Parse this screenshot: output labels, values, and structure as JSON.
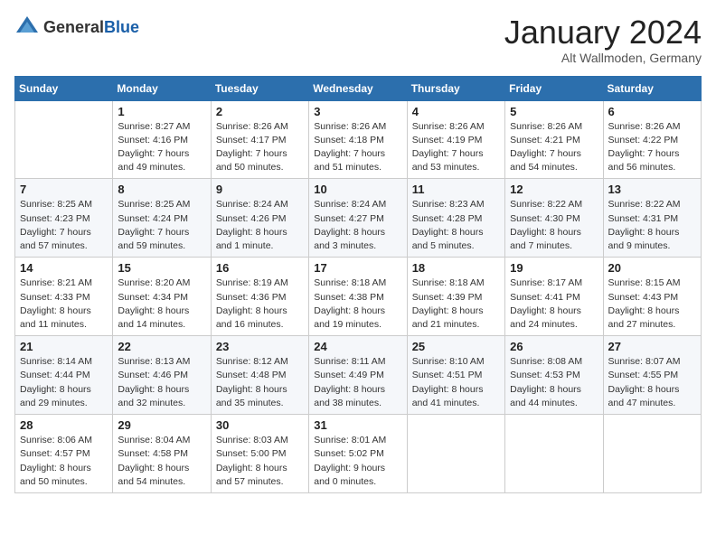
{
  "header": {
    "logo_general": "General",
    "logo_blue": "Blue",
    "month": "January 2024",
    "location": "Alt Wallmoden, Germany"
  },
  "calendar": {
    "days_of_week": [
      "Sunday",
      "Monday",
      "Tuesday",
      "Wednesday",
      "Thursday",
      "Friday",
      "Saturday"
    ],
    "weeks": [
      [
        {
          "day": "",
          "sunrise": "",
          "sunset": "",
          "daylight": ""
        },
        {
          "day": "1",
          "sunrise": "Sunrise: 8:27 AM",
          "sunset": "Sunset: 4:16 PM",
          "daylight": "Daylight: 7 hours and 49 minutes."
        },
        {
          "day": "2",
          "sunrise": "Sunrise: 8:26 AM",
          "sunset": "Sunset: 4:17 PM",
          "daylight": "Daylight: 7 hours and 50 minutes."
        },
        {
          "day": "3",
          "sunrise": "Sunrise: 8:26 AM",
          "sunset": "Sunset: 4:18 PM",
          "daylight": "Daylight: 7 hours and 51 minutes."
        },
        {
          "day": "4",
          "sunrise": "Sunrise: 8:26 AM",
          "sunset": "Sunset: 4:19 PM",
          "daylight": "Daylight: 7 hours and 53 minutes."
        },
        {
          "day": "5",
          "sunrise": "Sunrise: 8:26 AM",
          "sunset": "Sunset: 4:21 PM",
          "daylight": "Daylight: 7 hours and 54 minutes."
        },
        {
          "day": "6",
          "sunrise": "Sunrise: 8:26 AM",
          "sunset": "Sunset: 4:22 PM",
          "daylight": "Daylight: 7 hours and 56 minutes."
        }
      ],
      [
        {
          "day": "7",
          "sunrise": "Sunrise: 8:25 AM",
          "sunset": "Sunset: 4:23 PM",
          "daylight": "Daylight: 7 hours and 57 minutes."
        },
        {
          "day": "8",
          "sunrise": "Sunrise: 8:25 AM",
          "sunset": "Sunset: 4:24 PM",
          "daylight": "Daylight: 7 hours and 59 minutes."
        },
        {
          "day": "9",
          "sunrise": "Sunrise: 8:24 AM",
          "sunset": "Sunset: 4:26 PM",
          "daylight": "Daylight: 8 hours and 1 minute."
        },
        {
          "day": "10",
          "sunrise": "Sunrise: 8:24 AM",
          "sunset": "Sunset: 4:27 PM",
          "daylight": "Daylight: 8 hours and 3 minutes."
        },
        {
          "day": "11",
          "sunrise": "Sunrise: 8:23 AM",
          "sunset": "Sunset: 4:28 PM",
          "daylight": "Daylight: 8 hours and 5 minutes."
        },
        {
          "day": "12",
          "sunrise": "Sunrise: 8:22 AM",
          "sunset": "Sunset: 4:30 PM",
          "daylight": "Daylight: 8 hours and 7 minutes."
        },
        {
          "day": "13",
          "sunrise": "Sunrise: 8:22 AM",
          "sunset": "Sunset: 4:31 PM",
          "daylight": "Daylight: 8 hours and 9 minutes."
        }
      ],
      [
        {
          "day": "14",
          "sunrise": "Sunrise: 8:21 AM",
          "sunset": "Sunset: 4:33 PM",
          "daylight": "Daylight: 8 hours and 11 minutes."
        },
        {
          "day": "15",
          "sunrise": "Sunrise: 8:20 AM",
          "sunset": "Sunset: 4:34 PM",
          "daylight": "Daylight: 8 hours and 14 minutes."
        },
        {
          "day": "16",
          "sunrise": "Sunrise: 8:19 AM",
          "sunset": "Sunset: 4:36 PM",
          "daylight": "Daylight: 8 hours and 16 minutes."
        },
        {
          "day": "17",
          "sunrise": "Sunrise: 8:18 AM",
          "sunset": "Sunset: 4:38 PM",
          "daylight": "Daylight: 8 hours and 19 minutes."
        },
        {
          "day": "18",
          "sunrise": "Sunrise: 8:18 AM",
          "sunset": "Sunset: 4:39 PM",
          "daylight": "Daylight: 8 hours and 21 minutes."
        },
        {
          "day": "19",
          "sunrise": "Sunrise: 8:17 AM",
          "sunset": "Sunset: 4:41 PM",
          "daylight": "Daylight: 8 hours and 24 minutes."
        },
        {
          "day": "20",
          "sunrise": "Sunrise: 8:15 AM",
          "sunset": "Sunset: 4:43 PM",
          "daylight": "Daylight: 8 hours and 27 minutes."
        }
      ],
      [
        {
          "day": "21",
          "sunrise": "Sunrise: 8:14 AM",
          "sunset": "Sunset: 4:44 PM",
          "daylight": "Daylight: 8 hours and 29 minutes."
        },
        {
          "day": "22",
          "sunrise": "Sunrise: 8:13 AM",
          "sunset": "Sunset: 4:46 PM",
          "daylight": "Daylight: 8 hours and 32 minutes."
        },
        {
          "day": "23",
          "sunrise": "Sunrise: 8:12 AM",
          "sunset": "Sunset: 4:48 PM",
          "daylight": "Daylight: 8 hours and 35 minutes."
        },
        {
          "day": "24",
          "sunrise": "Sunrise: 8:11 AM",
          "sunset": "Sunset: 4:49 PM",
          "daylight": "Daylight: 8 hours and 38 minutes."
        },
        {
          "day": "25",
          "sunrise": "Sunrise: 8:10 AM",
          "sunset": "Sunset: 4:51 PM",
          "daylight": "Daylight: 8 hours and 41 minutes."
        },
        {
          "day": "26",
          "sunrise": "Sunrise: 8:08 AM",
          "sunset": "Sunset: 4:53 PM",
          "daylight": "Daylight: 8 hours and 44 minutes."
        },
        {
          "day": "27",
          "sunrise": "Sunrise: 8:07 AM",
          "sunset": "Sunset: 4:55 PM",
          "daylight": "Daylight: 8 hours and 47 minutes."
        }
      ],
      [
        {
          "day": "28",
          "sunrise": "Sunrise: 8:06 AM",
          "sunset": "Sunset: 4:57 PM",
          "daylight": "Daylight: 8 hours and 50 minutes."
        },
        {
          "day": "29",
          "sunrise": "Sunrise: 8:04 AM",
          "sunset": "Sunset: 4:58 PM",
          "daylight": "Daylight: 8 hours and 54 minutes."
        },
        {
          "day": "30",
          "sunrise": "Sunrise: 8:03 AM",
          "sunset": "Sunset: 5:00 PM",
          "daylight": "Daylight: 8 hours and 57 minutes."
        },
        {
          "day": "31",
          "sunrise": "Sunrise: 8:01 AM",
          "sunset": "Sunset: 5:02 PM",
          "daylight": "Daylight: 9 hours and 0 minutes."
        },
        {
          "day": "",
          "sunrise": "",
          "sunset": "",
          "daylight": ""
        },
        {
          "day": "",
          "sunrise": "",
          "sunset": "",
          "daylight": ""
        },
        {
          "day": "",
          "sunrise": "",
          "sunset": "",
          "daylight": ""
        }
      ]
    ]
  }
}
